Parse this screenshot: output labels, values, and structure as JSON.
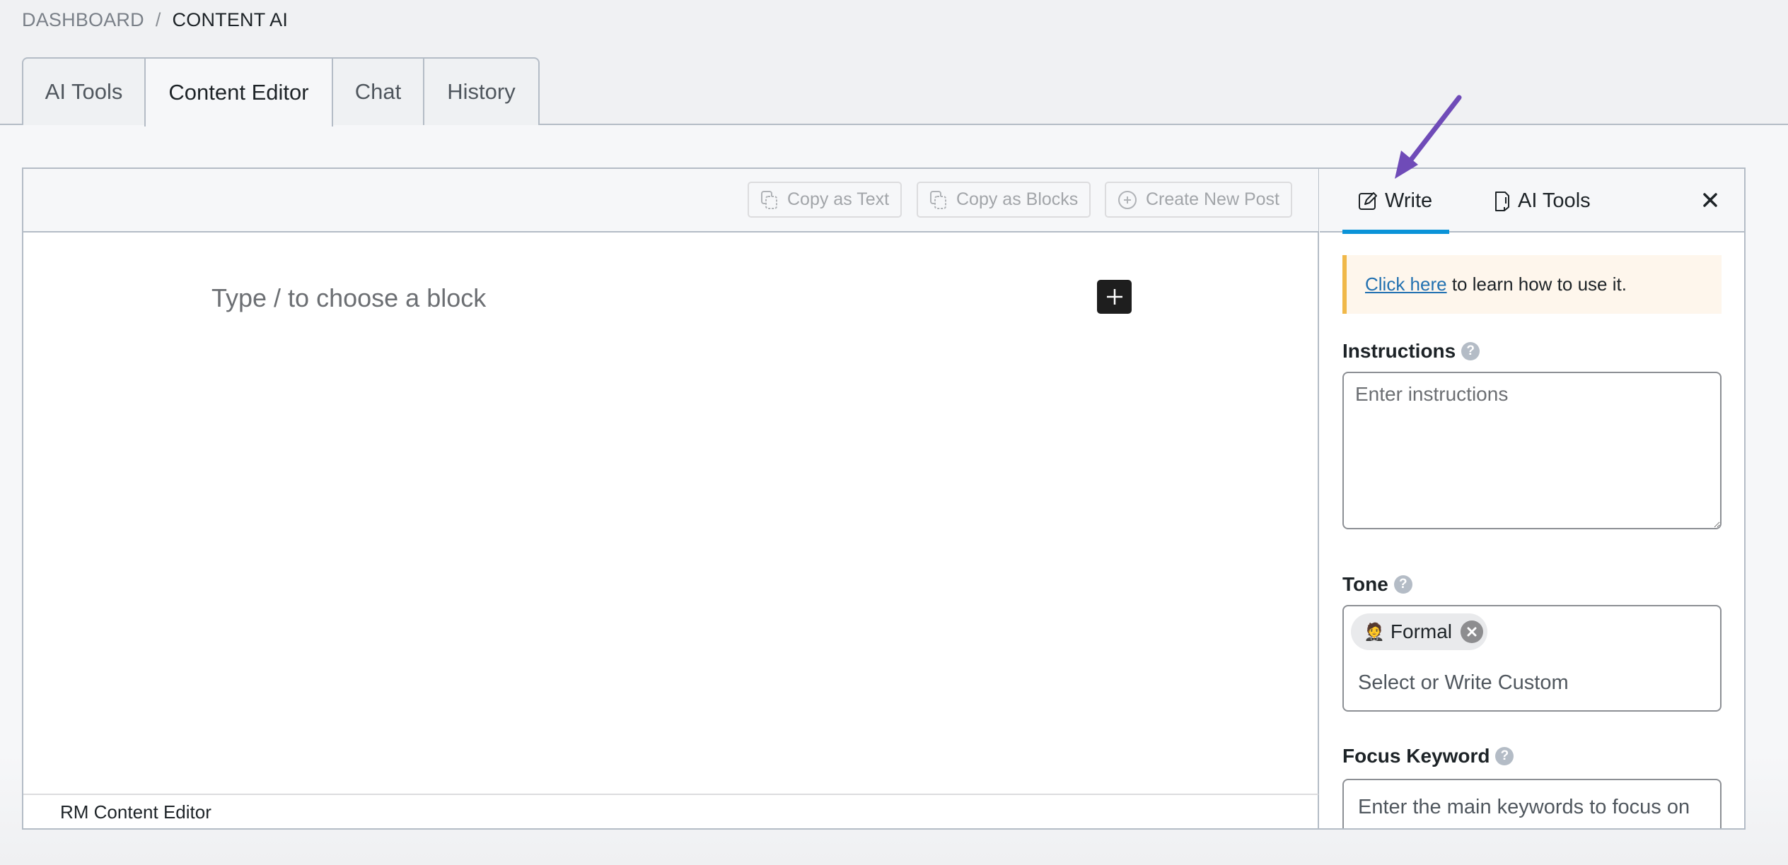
{
  "breadcrumb": {
    "parent": "DASHBOARD",
    "separator": "/",
    "current": "CONTENT AI"
  },
  "main_tabs": [
    {
      "label": "AI Tools",
      "active": false
    },
    {
      "label": "Content Editor",
      "active": true
    },
    {
      "label": "Chat",
      "active": false
    },
    {
      "label": "History",
      "active": false
    }
  ],
  "toolbar": {
    "copy_text_label": "Copy as Text",
    "copy_text_icon": "copy-icon",
    "copy_blocks_label": "Copy as Blocks",
    "copy_blocks_icon": "copy-icon",
    "create_post_label": "Create New Post",
    "create_post_icon": "plus-circle-icon"
  },
  "editor": {
    "placeholder": "Type / to choose a block",
    "add_block_icon": "plus-icon",
    "footer_label": "RM Content Editor"
  },
  "sidebar": {
    "tabs": [
      {
        "label": "Write",
        "icon": "edit-icon",
        "active": true
      },
      {
        "label": "AI Tools",
        "icon": "document-icon",
        "active": false
      }
    ],
    "close_icon": "close-icon",
    "info": {
      "link_text": "Click here",
      "text": " to learn how to use it."
    },
    "instructions": {
      "label": "Instructions",
      "help": "?",
      "placeholder": "Enter instructions",
      "value": ""
    },
    "tone": {
      "label": "Tone",
      "help": "?",
      "selected": [
        {
          "emoji": "🤵",
          "label": "Formal"
        }
      ],
      "placeholder": "Select or Write Custom",
      "value": ""
    },
    "focus_keyword": {
      "label": "Focus Keyword",
      "help": "?",
      "placeholder": "Enter the main keywords to focus on",
      "value": ""
    }
  },
  "colors": {
    "active_tab_underline": "#0a93d8",
    "info_border": "#f0b849",
    "info_background": "#fef6ec",
    "link": "#2271b1",
    "annotation_arrow": "#6f4bb8"
  }
}
